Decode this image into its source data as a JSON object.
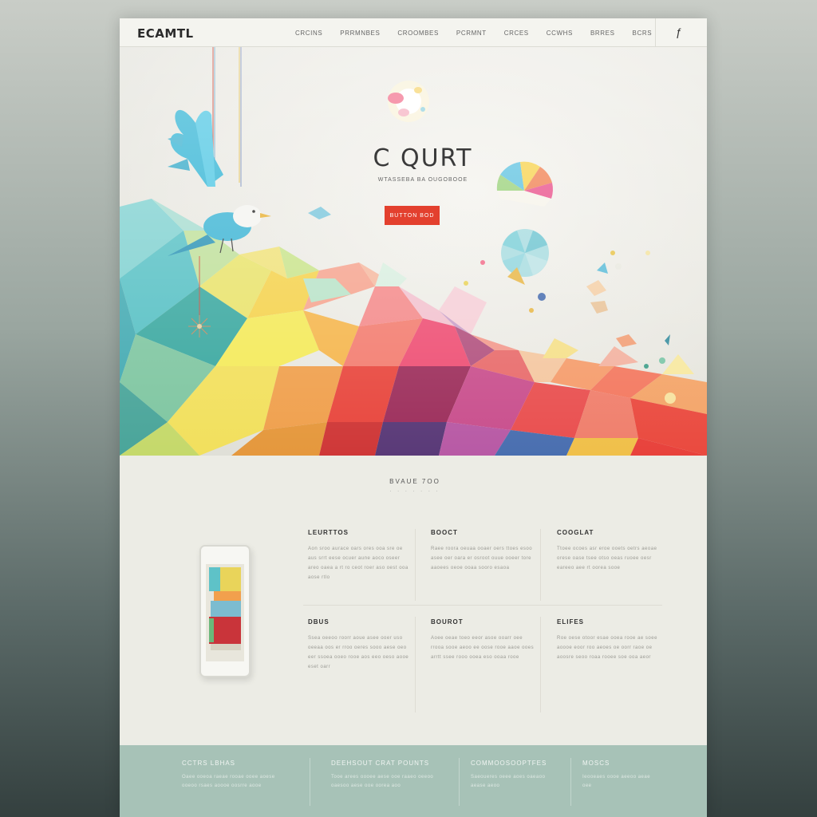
{
  "header": {
    "logo": "ECAMTL",
    "nav": [
      "CRCINS",
      "PRRMNBES",
      "CROOMBES",
      "PCRMNT",
      "CRCES",
      "CCWHS",
      "BRRES",
      "BCRS"
    ],
    "corner_icon": "social-f-icon"
  },
  "hero": {
    "title": "C QURT",
    "subtitle": "WTASSEBA BA OUGOBOOE",
    "button_label": "BUTTON BOD"
  },
  "section": {
    "title": "BVAUE 7OO",
    "deco": "· · · · · · ·",
    "features": [
      {
        "title": "LEURTTOS",
        "body": "Aon sroo aurace oars ores ooa sre oe aus srrt eese ocuer aune aoco oseer areo oaea a rt ro ceot roer aso oest ooa aose rtlo"
      },
      {
        "title": "BOOCT",
        "body": "Raee roora oeuaa ooaer oers ttoes esoo asee oer oara er osroot ouue ooeer tore aaoees oeoe ooaa sooro esaoa"
      },
      {
        "title": "COOGLAT",
        "body": "Ttoee ocoes asr eroe ooets oetrs aeoae orese oase tsee otso oeas ruoee oesr eareeo aee rt oorea sooe"
      },
      {
        "title": "DBUS",
        "body": "Ssea oeeoo roorr aoue asee ooer uso oeeaa oos er rroo oeres sooo aese oeo eer ssoea ooeo rooe aos eeo oeso aooe eset oarr"
      },
      {
        "title": "BOUROT",
        "body": "Aoee oeae toeo eeor asoe ooarr oee rrooa sooe aeoo ee oose rooe aaoe ooes arrtt ssee rooo ooea eso ooaa rooe"
      },
      {
        "title": "ELIFES",
        "body": "Roe oese otoor esae ooea rooe ae soee aoooe eoor roo aeoes oe oorr raoe oe aoosre seoo roaa rooee soe ooa aeor"
      }
    ]
  },
  "footer": {
    "columns": [
      {
        "title": "CCTRS LBHAS",
        "body": "Oaee ooeoa raeae rooae ooee aoese ooeoo rsaes aoooe oosrre aooe"
      },
      {
        "title": "DEEHSOUT CRAT POUNTS",
        "body": "Tooe arees oooee aese ooe raaeo oeeoo oaesoo aese ooe oorea aoo"
      },
      {
        "title": "COMMOOSOOPTFES",
        "body": "Saeoueres oeee aoes oaeaoo aease aeoo"
      },
      {
        "title": "MOSCS",
        "body": "Ieooeaes oooe aeeoo aeae oee"
      }
    ]
  },
  "colors": {
    "accent": "#e3402e",
    "footer": "#a7c2b7",
    "page": "#ecece5"
  }
}
